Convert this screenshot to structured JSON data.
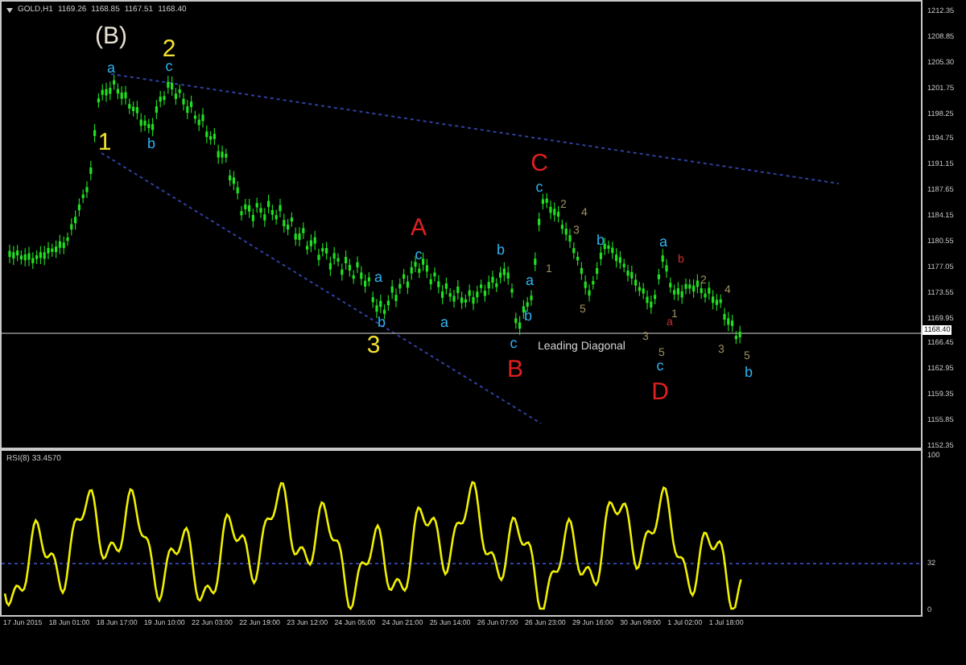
{
  "header": {
    "symbol": "GOLD,H1",
    "values": [
      "1169.26",
      "1168.85",
      "1167.51",
      "1168.40"
    ]
  },
  "price_axis": [
    "1212.35",
    "1208.85",
    "1205.30",
    "1201.75",
    "1198.25",
    "1194.75",
    "1191.15",
    "1187.65",
    "1184.15",
    "1180.55",
    "1177.05",
    "1173.55",
    "1169.95",
    "1166.45",
    "1162.95",
    "1159.35",
    "1155.85",
    "1152.35"
  ],
  "current_price": "1168.40",
  "annotations": [
    {
      "text": "(B)",
      "kind": "major",
      "color": "#e8e0d0"
    },
    {
      "text": "2",
      "kind": "major",
      "color": "#f0e030"
    },
    {
      "text": "a",
      "kind": "minor",
      "color": "#30b0f0"
    },
    {
      "text": "c",
      "kind": "minor",
      "color": "#30b0f0"
    },
    {
      "text": "1",
      "kind": "major",
      "color": "#f0e030"
    },
    {
      "text": "b",
      "kind": "minor",
      "color": "#30b0f0"
    },
    {
      "text": "A",
      "kind": "major",
      "color": "#e02020"
    },
    {
      "text": "c",
      "kind": "minor",
      "color": "#30b0f0"
    },
    {
      "text": "a",
      "kind": "minor",
      "color": "#30b0f0"
    },
    {
      "text": "b",
      "kind": "minor",
      "color": "#30b0f0"
    },
    {
      "text": "3",
      "kind": "major",
      "color": "#f0e030"
    },
    {
      "text": "a",
      "kind": "minor",
      "color": "#30b0f0"
    },
    {
      "text": "b",
      "kind": "minor",
      "color": "#30b0f0"
    },
    {
      "text": "a",
      "kind": "minor",
      "color": "#30b0f0"
    },
    {
      "text": "b",
      "kind": "minor",
      "color": "#30b0f0"
    },
    {
      "text": "c",
      "kind": "minor",
      "color": "#30b0f0"
    },
    {
      "text": "B",
      "kind": "major",
      "color": "#e02020"
    },
    {
      "text": "C",
      "kind": "major",
      "color": "#e02020"
    },
    {
      "text": "c",
      "kind": "minor",
      "color": "#30b0f0"
    },
    {
      "text": "2",
      "kind": "tiny",
      "color": "#a09060"
    },
    {
      "text": "4",
      "kind": "tiny",
      "color": "#a09060"
    },
    {
      "text": "3",
      "kind": "tiny",
      "color": "#a09060"
    },
    {
      "text": "1",
      "kind": "tiny",
      "color": "#a09060"
    },
    {
      "text": "5",
      "kind": "tiny",
      "color": "#a09060"
    },
    {
      "text": "b",
      "kind": "minor",
      "color": "#30b0f0"
    },
    {
      "text": "a",
      "kind": "minor",
      "color": "#30b0f0"
    },
    {
      "text": "b",
      "kind": "tiny",
      "color": "#d03030"
    },
    {
      "text": "2",
      "kind": "tiny",
      "color": "#a09060"
    },
    {
      "text": "4",
      "kind": "tiny",
      "color": "#a09060"
    },
    {
      "text": "1",
      "kind": "tiny",
      "color": "#a09060"
    },
    {
      "text": "a",
      "kind": "tiny",
      "color": "#d03030"
    },
    {
      "text": "3",
      "kind": "tiny",
      "color": "#a09060"
    },
    {
      "text": "5",
      "kind": "tiny",
      "color": "#a09060"
    },
    {
      "text": "c",
      "kind": "minor",
      "color": "#30b0f0"
    },
    {
      "text": "D",
      "kind": "major",
      "color": "#e02020"
    },
    {
      "text": "3",
      "kind": "tiny",
      "color": "#a09060"
    },
    {
      "text": "5",
      "kind": "tiny",
      "color": "#a09060"
    },
    {
      "text": "b",
      "kind": "minor",
      "color": "#30b0f0"
    },
    {
      "text": "Leading Diagonal",
      "kind": "note",
      "color": "#d0d0d0"
    }
  ],
  "rsi": {
    "label": "RSI(8) 33.4570",
    "axis": [
      "100",
      "32",
      "0"
    ]
  },
  "time_axis": [
    "17 Jun 2015",
    "18 Jun 01:00",
    "18 Jun 17:00",
    "19 Jun 10:00",
    "22 Jun 03:00",
    "22 Jun 19:00",
    "23 Jun 12:00",
    "24 Jun 05:00",
    "24 Jun 21:00",
    "25 Jun 14:00",
    "26 Jun 07:00",
    "26 Jun 23:00",
    "29 Jun 16:00",
    "30 Jun 09:00",
    "1 Jul 02:00",
    "1 Jul 18:00"
  ]
}
